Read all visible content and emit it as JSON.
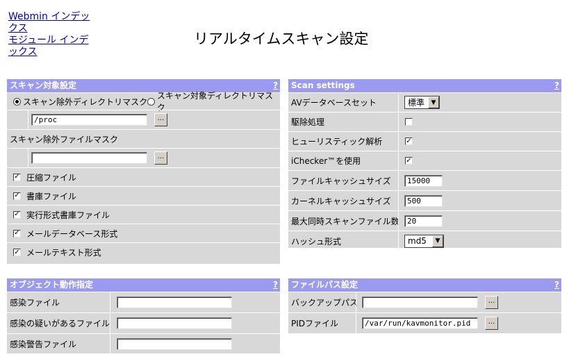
{
  "nav": {
    "webmin_index": "Webmin インデックス",
    "module_index": "モジュール インデックス"
  },
  "title": "リアルタイムスキャン設定",
  "help_label": "?",
  "browse_label": "...",
  "scan_target": {
    "header": "スキャン対象設定",
    "radio_exclude": "スキャン除外ディレクトリマスク",
    "radio_include": "スキャン対象ディレクトリマスク",
    "dir_mask_value": "/proc",
    "file_mask_label": "スキャン除外ファイルマスク",
    "file_mask_value": "",
    "checks": [
      {
        "label": "圧縮ファイル",
        "checked": true
      },
      {
        "label": "書庫ファイル",
        "checked": true
      },
      {
        "label": "実行形式書庫ファイル",
        "checked": true
      },
      {
        "label": "メールデータベース形式",
        "checked": true
      },
      {
        "label": "メールテキスト形式",
        "checked": true
      }
    ]
  },
  "scan_settings": {
    "header": "Scan settings",
    "av_db_label": "AVデータベースセット",
    "av_db_value": "標準",
    "cure_label": "駆除処理",
    "heuristic_label": "ヒューリスティック解析",
    "ichecker_label": "iChecker™を使用",
    "file_cache_label": "ファイルキャッシュサイズ",
    "file_cache_value": "15000",
    "kernel_cache_label": "カーネルキャッシュサイズ",
    "kernel_cache_value": "500",
    "max_files_label": "最大同時スキャンファイル数",
    "max_files_value": "20",
    "hash_label": "ハッシュ形式",
    "hash_value": "md5"
  },
  "object_action": {
    "header": "オブジェクト動作指定",
    "infected_label": "感染ファイル",
    "suspicious_label": "感染の疑いがあるファイル",
    "warning_label": "感染警告ファイル",
    "infected_value": "",
    "suspicious_value": "",
    "warning_value": ""
  },
  "file_paths": {
    "header": "ファイルパス設定",
    "backup_label": "バックアップパス",
    "backup_value": "",
    "pid_label": "PIDファイル",
    "pid_value": "/var/run/kavmonitor.pid"
  }
}
